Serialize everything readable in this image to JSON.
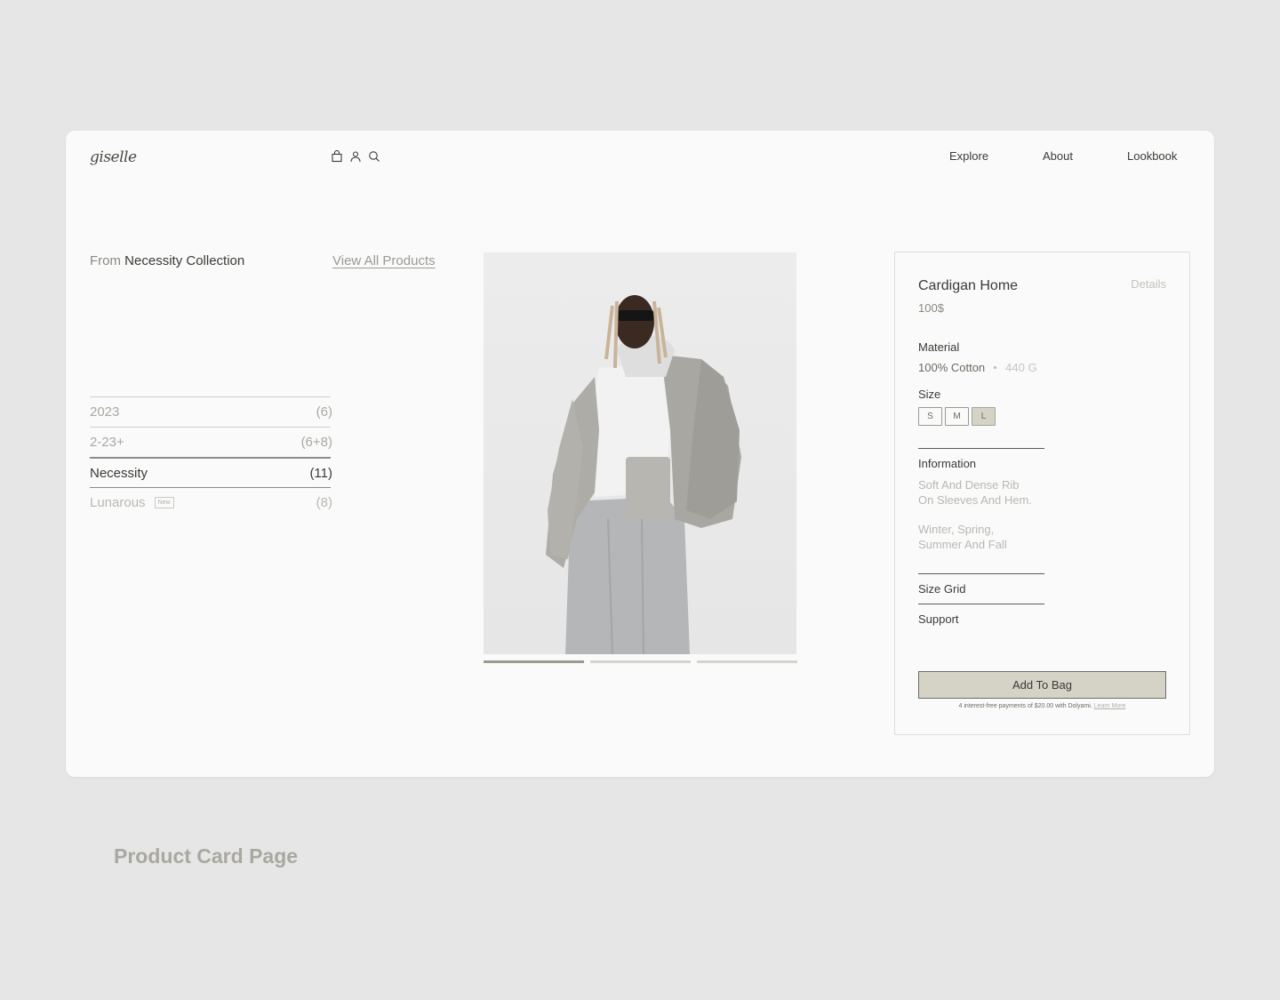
{
  "header": {
    "logo": "giselle",
    "icons": [
      "bag-icon",
      "user-icon",
      "search-icon"
    ],
    "nav": [
      "Explore",
      "About",
      "Lookbook"
    ]
  },
  "collection_header": {
    "from_prefix": "From",
    "collection_name": "Necessity Collection",
    "view_all": "View All Products"
  },
  "collections": [
    {
      "name": "2023",
      "count": "(6)",
      "active": false
    },
    {
      "name": "2-23+",
      "count": "(6+8)",
      "active": false
    },
    {
      "name": "Necessity",
      "count": "(11)",
      "active": true
    },
    {
      "name": "Lunarous",
      "count": "(8)",
      "active": false,
      "badge": "New"
    }
  ],
  "carousel": {
    "slides": 3,
    "active_index": 0
  },
  "product": {
    "title": "Cardigan Home",
    "details_link": "Details",
    "price": "100$",
    "material_label": "Material",
    "material_value": "100% Cotton",
    "material_weight": "440 G",
    "size_label": "Size",
    "sizes": [
      "S",
      "M",
      "L"
    ],
    "selected_size": "L",
    "information_label": "Information",
    "information_line1a": "Soft And Dense Rib",
    "information_line1b": "On Sleeves And Hem.",
    "information_line2a": "Winter, Spring,",
    "information_line2b": "Summer And Fall",
    "size_grid_label": "Size Grid",
    "support_label": "Support",
    "add_to_bag": "Add To Bag",
    "payment_note": "4 interest-free payments of $20.00 with Dolyami.",
    "learn_more": "Learn More"
  },
  "colors": {
    "page_bg": "#e6e6e6",
    "card_bg": "#fafafa",
    "accent": "#d5d3c6",
    "text": "#3a3a36",
    "muted": "#a8a8a2"
  },
  "page_caption": "Product Card Page"
}
